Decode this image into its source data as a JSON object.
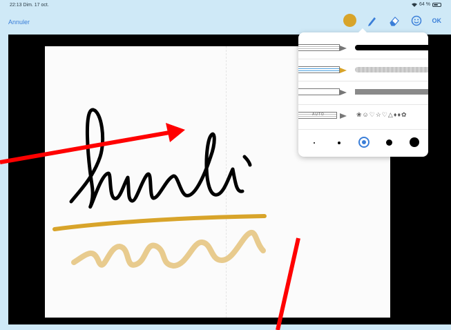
{
  "status": {
    "time": "22:13  Dim. 17 oct.",
    "battery": "64 %",
    "battery_level": 0.64
  },
  "toolbar": {
    "cancel_label": "Annuler",
    "ok_label": "OK",
    "selected_color": "#d8a42a",
    "accent": "#3a7ed8"
  },
  "canvas": {
    "text": "lundi"
  },
  "pen_menu": {
    "pens": [
      {
        "name": "felt-pen",
        "color": "#000000"
      },
      {
        "name": "glitter-pen",
        "color": "#c8c8c8"
      },
      {
        "name": "marker",
        "color": "#8a8a8a"
      },
      {
        "name": "stamp-pen",
        "label": "AUTO",
        "sample": "❀☺♡☆♡△♦♦✿"
      }
    ],
    "sizes": [
      "xs",
      "s",
      "m",
      "l",
      "xl"
    ],
    "selected_size": "m"
  },
  "annotations": {
    "arrow_color": "#ff0000"
  }
}
